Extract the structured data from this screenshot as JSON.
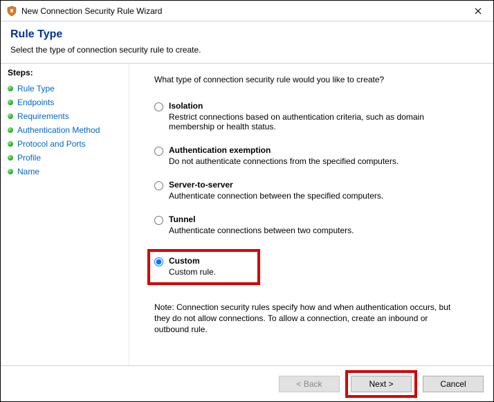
{
  "window": {
    "title": "New Connection Security Rule Wizard"
  },
  "header": {
    "title": "Rule Type",
    "subtitle": "Select the type of connection security rule to create."
  },
  "sidebar": {
    "label": "Steps:",
    "items": [
      {
        "label": "Rule Type"
      },
      {
        "label": "Endpoints"
      },
      {
        "label": "Requirements"
      },
      {
        "label": "Authentication Method"
      },
      {
        "label": "Protocol and Ports"
      },
      {
        "label": "Profile"
      },
      {
        "label": "Name"
      }
    ]
  },
  "main": {
    "prompt": "What type of connection security rule would you like to create?",
    "options": [
      {
        "label": "Isolation",
        "desc": "Restrict connections based on authentication criteria, such as domain membership or health status."
      },
      {
        "label": "Authentication exemption",
        "desc": "Do not authenticate connections from the specified computers."
      },
      {
        "label": "Server-to-server",
        "desc": "Authenticate connection between the specified computers."
      },
      {
        "label": "Tunnel",
        "desc": "Authenticate connections between two computers."
      },
      {
        "label": "Custom",
        "desc": "Custom rule."
      }
    ],
    "selected_index": 4,
    "note": "Note:  Connection security rules specify how and when authentication occurs, but they do not allow connections.  To allow a connection, create an inbound or outbound rule."
  },
  "footer": {
    "back": "< Back",
    "next": "Next >",
    "cancel": "Cancel"
  }
}
